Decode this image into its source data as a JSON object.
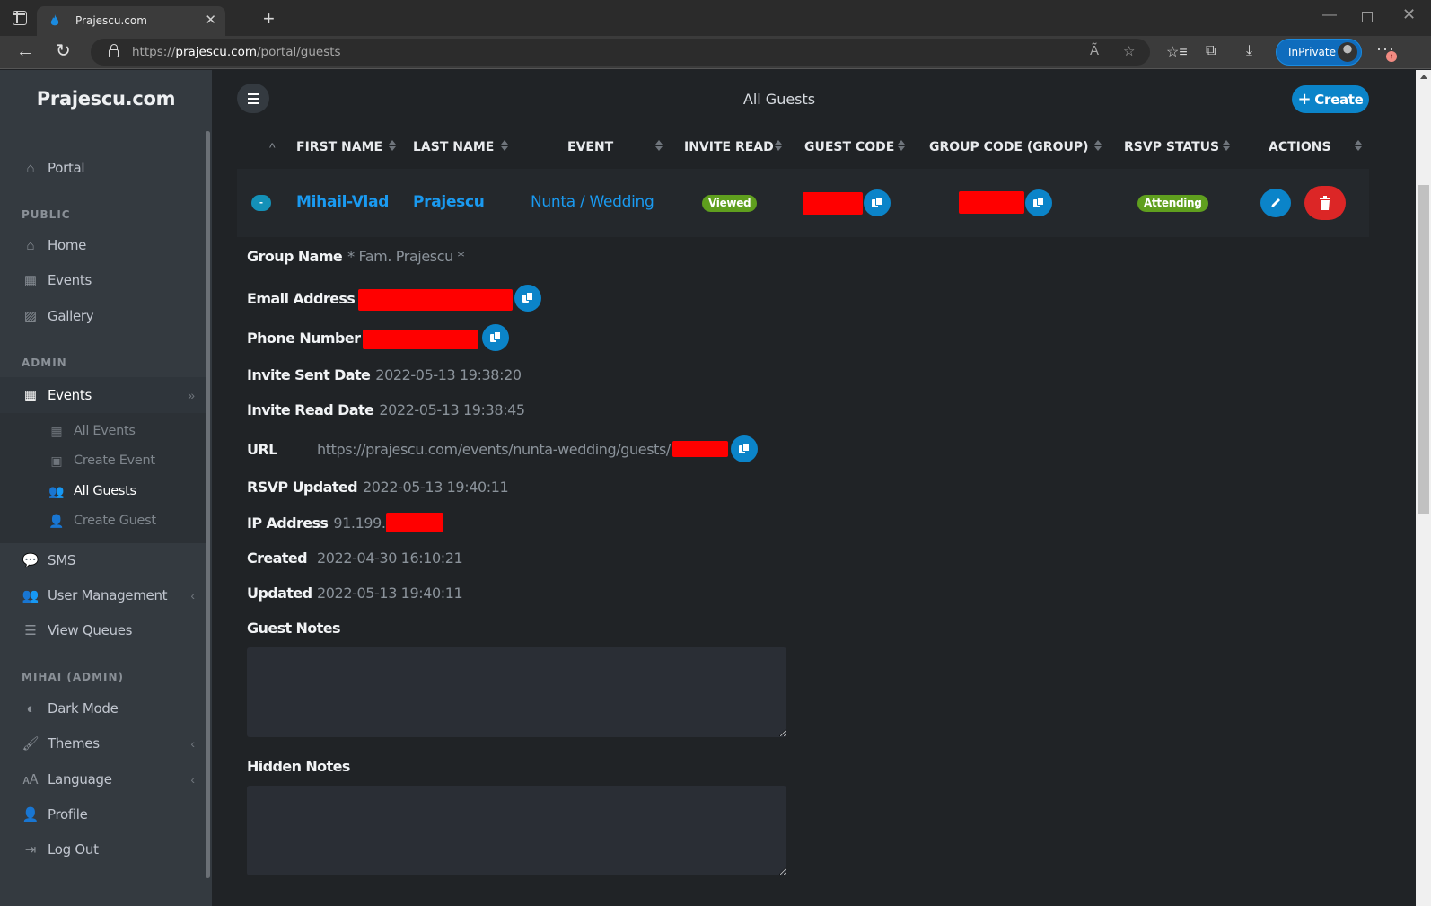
{
  "browser": {
    "tab_title": "Prajescu.com",
    "url_scheme": "https://",
    "url_host": "prajescu.com",
    "url_path": "/portal/guests",
    "inprivate_label": "InPrivate"
  },
  "sidebar": {
    "brand": "Prajescu.com",
    "portal": {
      "label": "Portal",
      "icon": "house-user-icon"
    },
    "public_header": "PUBLIC",
    "public_items": [
      {
        "label": "Home",
        "icon": "home-icon"
      },
      {
        "label": "Events",
        "icon": "calendar-icon"
      },
      {
        "label": "Gallery",
        "icon": "images-icon"
      }
    ],
    "admin_header": "ADMIN",
    "admin_events": {
      "label": "Events",
      "icon": "calendar-icon",
      "expanded": true
    },
    "events_submenu": [
      {
        "label": "All Events",
        "icon": "calendar-icon",
        "active": false
      },
      {
        "label": "Create Event",
        "icon": "calendar-plus-icon",
        "active": false
      },
      {
        "label": "All Guests",
        "icon": "users-icon",
        "active": true
      },
      {
        "label": "Create Guest",
        "icon": "user-tie-icon",
        "active": false
      }
    ],
    "admin_items": [
      {
        "label": "SMS",
        "icon": "sms-icon"
      },
      {
        "label": "User Management",
        "icon": "users-icon",
        "has_submenu": true
      },
      {
        "label": "View Queues",
        "icon": "list-icon"
      }
    ],
    "user_header": "MIHAI (ADMIN)",
    "user_items": [
      {
        "label": "Dark Mode",
        "icon": "circle-half-icon"
      },
      {
        "label": "Themes",
        "icon": "brush-icon",
        "has_submenu": true
      },
      {
        "label": "Language",
        "icon": "language-icon",
        "has_submenu": true
      },
      {
        "label": "Profile",
        "icon": "user-cog-icon"
      },
      {
        "label": "Log Out",
        "icon": "sign-out-icon"
      }
    ]
  },
  "main": {
    "title": "All Guests",
    "create_label": "Create",
    "columns": [
      "FIRST NAME",
      "LAST NAME",
      "EVENT",
      "INVITE READ",
      "GUEST CODE",
      "GROUP CODE (GROUP)",
      "RSVP STATUS",
      "ACTIONS"
    ],
    "row": {
      "expand_symbol": "-",
      "first_name": "Mihail-Vlad",
      "last_name": "Prajescu",
      "event": "Nunta / Wedding",
      "invite_read": "Viewed",
      "guest_code": "[redacted]",
      "group_code": "[redacted]",
      "rsvp_status": "Attending"
    },
    "details": {
      "group_name_label": "Group Name",
      "group_name_value": "* Fam. Prajescu *",
      "email_label": "Email Address",
      "phone_label": "Phone Number",
      "invite_sent_label": "Invite Sent Date",
      "invite_sent_value": "2022-05-13 19:38:20",
      "invite_read_label": "Invite Read Date",
      "invite_read_value": "2022-05-13 19:38:45",
      "url_label": "URL",
      "url_value": "https://prajescu.com/events/nunta-wedding/guests/",
      "rsvp_updated_label": "RSVP Updated",
      "rsvp_updated_value": "2022-05-13 19:40:11",
      "ip_label": "IP Address",
      "ip_value": "91.199.",
      "created_label": "Created",
      "created_value": "2022-04-30 16:10:21",
      "updated_label": "Updated",
      "updated_value": "2022-05-13 19:40:11",
      "guest_notes_label": "Guest Notes",
      "guest_notes_value": "",
      "hidden_notes_label": "Hidden Notes",
      "hidden_notes_value": ""
    }
  },
  "colors": {
    "accent": "#0b84c9",
    "link": "#1a9af0",
    "success_badge": "#5f9f1e",
    "danger": "#dc2626",
    "redaction": "#ff0000"
  }
}
